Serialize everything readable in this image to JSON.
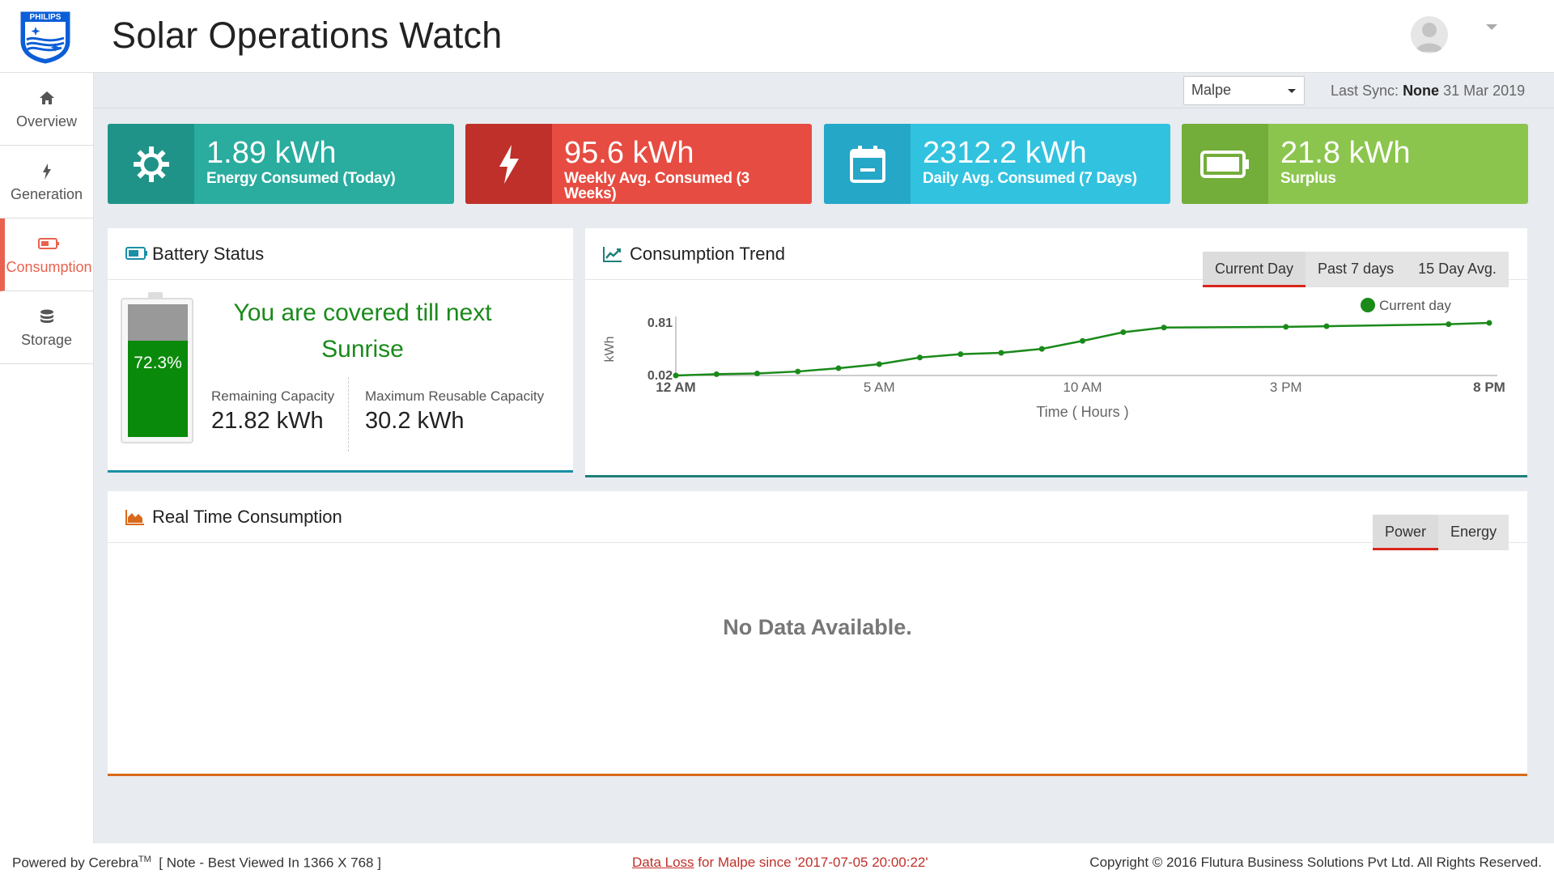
{
  "header": {
    "logo_text": "PHILIPS",
    "title": "Solar Operations Watch"
  },
  "sidebar": {
    "items": [
      {
        "label": "Overview",
        "icon": "home-icon"
      },
      {
        "label": "Generation",
        "icon": "bolt-icon"
      },
      {
        "label": "Consumption",
        "icon": "battery-icon",
        "active": true
      },
      {
        "label": "Storage",
        "icon": "database-icon"
      }
    ]
  },
  "toolbar": {
    "site_selected": "Malpe",
    "last_sync_label": "Last Sync:",
    "last_sync_status": "None",
    "last_sync_date": "31 Mar 2019"
  },
  "kpis": [
    {
      "value": "1.89 kWh",
      "label": "Energy Consumed (Today)",
      "icon": "sun-icon",
      "color": "#2aac9f"
    },
    {
      "value": "95.6 kWh",
      "label": "Weekly Avg. Consumed (3 Weeks)",
      "icon": "bolt-icon",
      "color": "#e64c41"
    },
    {
      "value": "2312.2 kWh",
      "label": "Daily Avg. Consumed (7 Days)",
      "icon": "calendar-icon",
      "color": "#31c2df"
    },
    {
      "value": "21.8 kWh",
      "label": "Surplus",
      "icon": "battery-icon",
      "color": "#8bc54e"
    }
  ],
  "battery": {
    "title": "Battery Status",
    "percent_label": "72.3%",
    "percent": 72.3,
    "message": "You are covered till next Sunrise",
    "remaining_label": "Remaining Capacity",
    "remaining_value": "21.82 kWh",
    "max_label": "Maximum Reusable Capacity",
    "max_value": "30.2 kWh"
  },
  "trend": {
    "title": "Consumption Trend",
    "tabs": [
      "Current Day",
      "Past 7 days",
      "15 Day Avg."
    ],
    "selected_tab": "Current Day"
  },
  "chart_data": {
    "type": "line",
    "title": "",
    "xlabel": "Time ( Hours )",
    "ylabel": "kWh",
    "x_tick_labels": [
      "12 AM",
      "5 AM",
      "10 AM",
      "3 PM",
      "8 PM"
    ],
    "x_ticks": [
      0,
      5,
      10,
      15,
      20
    ],
    "y_tick_labels": [
      "0.02",
      "0.81"
    ],
    "ylim": [
      0.02,
      0.81
    ],
    "xlim": [
      0,
      20
    ],
    "legend_position": "top-right",
    "grid": false,
    "series": [
      {
        "name": "Current day",
        "color": "#1a8a1a",
        "x": [
          0,
          1,
          2,
          3,
          4,
          5,
          6,
          7,
          8,
          9,
          10,
          11,
          12,
          15,
          16,
          19,
          20
        ],
        "y": [
          0.02,
          0.04,
          0.05,
          0.08,
          0.13,
          0.19,
          0.29,
          0.34,
          0.36,
          0.42,
          0.54,
          0.67,
          0.74,
          0.75,
          0.76,
          0.79,
          0.81
        ]
      }
    ]
  },
  "realtime": {
    "title": "Real Time Consumption",
    "tabs": [
      "Power",
      "Energy"
    ],
    "selected_tab": "Power",
    "empty_message": "No Data Available."
  },
  "footer": {
    "powered_by": "Powered by Cerebra",
    "tm": "TM",
    "note": "[ Note - Best Viewed In 1366 X 768 ]",
    "data_loss_link": "Data Loss",
    "data_loss_text": "for Malpe since '2017-07-05 20:00:22'",
    "copyright": "Copyright © 2016 Flutura Business Solutions Pvt Ltd. All Rights Reserved."
  }
}
